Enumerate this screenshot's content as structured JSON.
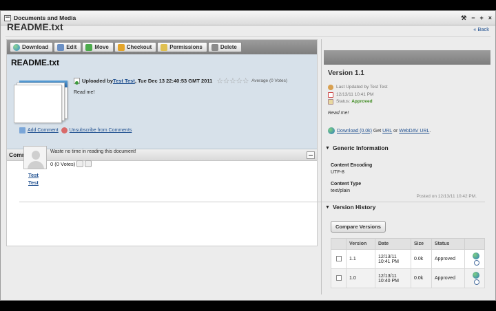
{
  "window": {
    "title": "Documents and Media",
    "controls": [
      "⚒",
      "−",
      "+",
      "×"
    ]
  },
  "page": {
    "title": "README.txt",
    "back_label": "« Back"
  },
  "toolbar": {
    "buttons": [
      {
        "label": "Download",
        "icon": "globe-icon",
        "color": "#2f8ad0"
      },
      {
        "label": "Edit",
        "icon": "edit-icon",
        "color": "#6a8fc4"
      },
      {
        "label": "Move",
        "icon": "move-icon",
        "color": "#4caa4c"
      },
      {
        "label": "Checkout",
        "icon": "lock-icon",
        "color": "#e3a42a"
      },
      {
        "label": "Permissions",
        "icon": "key-icon",
        "color": "#e0c050"
      },
      {
        "label": "Delete",
        "icon": "trash-icon",
        "color": "#8a8a8a"
      }
    ]
  },
  "document": {
    "title": "README.txt",
    "uploaded_prefix": "Uploaded by ",
    "uploader": "Test Test",
    "uploaded_date": ", Tue Dec 13 22:40:53 GMT 2011",
    "stars": "☆☆☆☆☆",
    "rating_text": "Average (0 Votes)",
    "description": "Read me!"
  },
  "comments": {
    "header": "Comments",
    "add_comment": "Add Comment",
    "unsubscribe": "Unsubscribe from Comments",
    "items": [
      {
        "text": "Waste no time in reading this document!",
        "votes": "0 (0 Votes)",
        "author_first": "Test",
        "author_last": "Test",
        "posted": "Posted on 12/13/11 10:42 PM."
      }
    ]
  },
  "version_panel": {
    "title": "Version 1.1",
    "last_updated": "Last Updated by Test Test",
    "date": "12/13/11 10:41 PM",
    "status_label": "Status:",
    "status_value": "Approved",
    "status_color": "#3d8a1f",
    "description": "Read me!",
    "download_link": "Download (0.0k)",
    "get_text": " Get ",
    "url_link": "URL",
    "or_text": " or ",
    "webdav_link": "WebDAV URL",
    "period": "."
  },
  "generic_info": {
    "header": "Generic Information",
    "content_encoding_label": "Content Encoding",
    "content_encoding_value": "UTF-8",
    "content_type_label": "Content Type",
    "content_type_value": "text/plain"
  },
  "version_history": {
    "header": "Version History",
    "compare_button": "Compare Versions",
    "columns": [
      "Version",
      "Date",
      "Size",
      "Status"
    ],
    "rows": [
      {
        "version": "1.1",
        "date_line1": "12/13/11",
        "date_line2": "10:41 PM",
        "size": "0.0k",
        "status": "Approved"
      },
      {
        "version": "1.0",
        "date_line1": "12/13/11",
        "date_line2": "10:40 PM",
        "size": "0.0k",
        "status": "Approved"
      }
    ]
  }
}
